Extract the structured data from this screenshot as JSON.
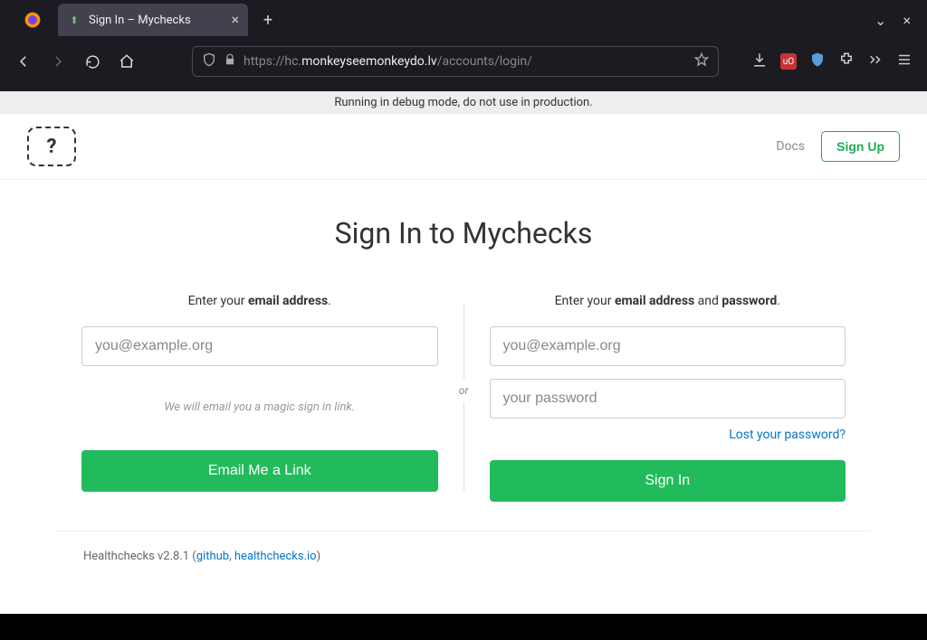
{
  "browser": {
    "tab_title": "Sign In – Mychecks",
    "url_proto": "https://",
    "url_sub": "hc.",
    "url_domain": "monkeyseemonkeydo.lv",
    "url_path": "/accounts/login/"
  },
  "banner": "Running in debug mode, do not use in production.",
  "header": {
    "logo_glyph": "?",
    "docs": "Docs",
    "signup": "Sign Up"
  },
  "title": "Sign In to Mychecks",
  "left": {
    "prompt_a": "Enter your ",
    "prompt_b": "email address",
    "prompt_c": ".",
    "email_placeholder": "you@example.org",
    "hint": "We will email you a magic sign in link.",
    "button": "Email Me a Link"
  },
  "or": "or",
  "right": {
    "prompt_a": "Enter your ",
    "prompt_b": "email address",
    "prompt_c": " and ",
    "prompt_d": "password",
    "prompt_e": ".",
    "email_placeholder": "you@example.org",
    "password_placeholder": "your password",
    "lost": "Lost your password?",
    "button": "Sign In"
  },
  "footer": {
    "version_a": "Healthchecks v2.8.1 (",
    "github": "github",
    "sep": ", ",
    "site": "healthchecks.io",
    "version_b": ")"
  }
}
